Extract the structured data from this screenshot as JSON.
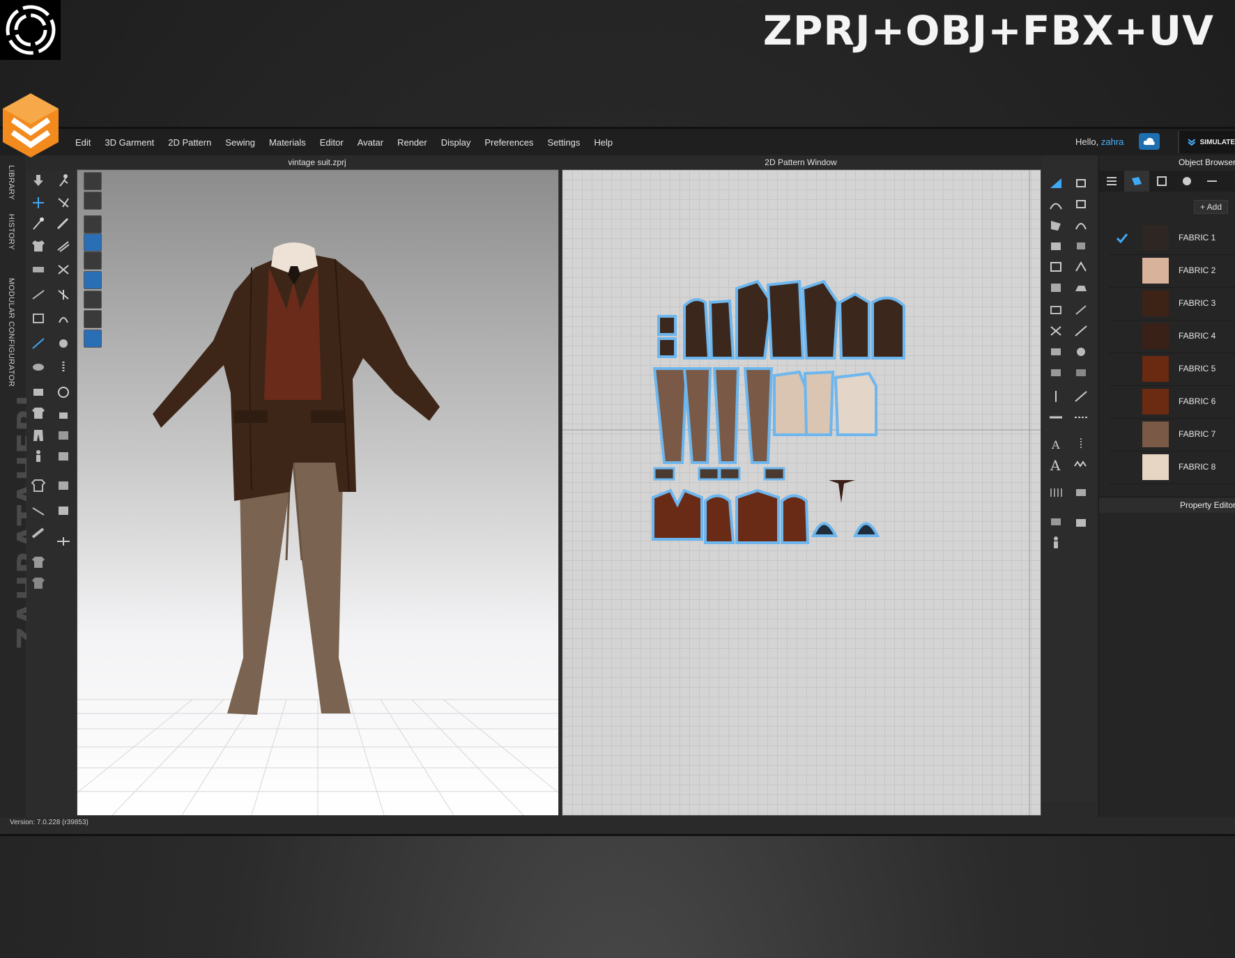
{
  "banner": {
    "title": "ZPRJ+OBJ+FBX+UV"
  },
  "watermark": "ZAHRATAHERI",
  "menu": [
    "Edit",
    "3D Garment",
    "2D Pattern",
    "Sewing",
    "Materials",
    "Editor",
    "Avatar",
    "Render",
    "Display",
    "Preferences",
    "Settings",
    "Help"
  ],
  "user": {
    "greeting": "Hello,",
    "name": "zahra"
  },
  "simulate_label": "SIMULATE",
  "vertical_tabs": [
    "LIBRARY",
    "HISTORY",
    "MODULAR CONFIGURATOR"
  ],
  "viewport3d": {
    "title": "vintage suit.zprj"
  },
  "viewport2d": {
    "title": "2D Pattern Window"
  },
  "object_browser": {
    "title": "Object Browser",
    "add_label": "+ Add",
    "fabrics": [
      {
        "name": "FABRIC 1",
        "color": "#2e2622",
        "checked": true
      },
      {
        "name": "FABRIC 2",
        "color": "#d9b29c",
        "checked": false
      },
      {
        "name": "FABRIC 3",
        "color": "#3d2316",
        "checked": false
      },
      {
        "name": "FABRIC 4",
        "color": "#3a2118",
        "checked": false
      },
      {
        "name": "FABRIC 5",
        "color": "#6a2a12",
        "checked": false
      },
      {
        "name": "FABRIC 6",
        "color": "#6b2b12",
        "checked": false
      },
      {
        "name": "FABRIC 7",
        "color": "#7a5a47",
        "checked": false
      },
      {
        "name": "FABRIC 8",
        "color": "#e8d6c4",
        "checked": false
      }
    ]
  },
  "property_editor": {
    "title": "Property Editor"
  },
  "version": "Version: 7.0.228 (r39853)",
  "colors": {
    "accent": "#4ab3ff",
    "brand_orange": "#f28a1e"
  }
}
